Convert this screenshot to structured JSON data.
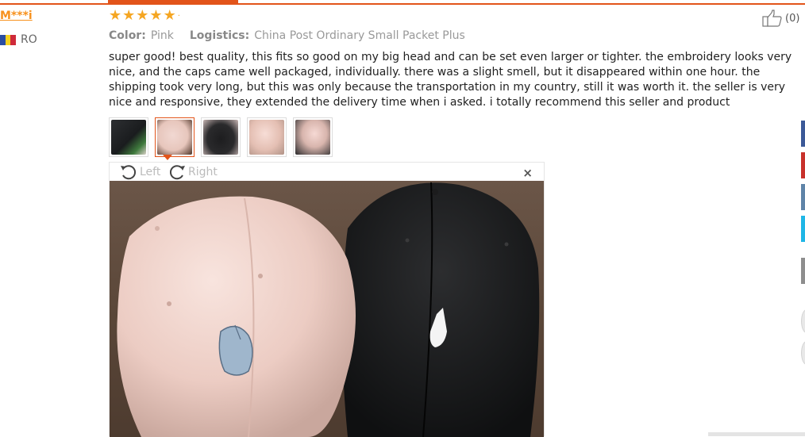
{
  "reviewer": {
    "name": "M***i",
    "country_code": "RO",
    "flag_colors": [
      "#2b4ea2",
      "#f6d21f",
      "#cf2a3a"
    ]
  },
  "rating": {
    "stars": 5,
    "max": 5
  },
  "meta": {
    "color_label": "Color:",
    "color_value": "Pink",
    "logistics_label": "Logistics:",
    "logistics_value": "China Post Ordinary Small Packet Plus"
  },
  "like": {
    "count_text": "(0)",
    "icon": "thumbs-up-icon"
  },
  "review_text": "super good! best quality, this fits so good on my big head and can be set even larger or tighter. the embroidery looks very nice, and the caps came well packaged, individually. there was a slight smell, but it disappeared within one hour. the shipping took very long, but this was only because the transportation in my country, still it was worth it. the seller is very nice and responsive, they extended the delivery time when i asked. i totally recommend this seller and product",
  "thumbnails": {
    "count": 5,
    "active_index": 2
  },
  "viewer": {
    "rotate_left_label": "Left",
    "rotate_right_label": "Right",
    "close_glyph": "×"
  },
  "colors": {
    "accent": "#e2541a",
    "star": "#f5a623",
    "username": "#f7911d",
    "side_tabs": [
      "#3b5998",
      "#c8312b",
      "#5f84a8",
      "#1fb6e6",
      "#8e8e8e"
    ]
  }
}
